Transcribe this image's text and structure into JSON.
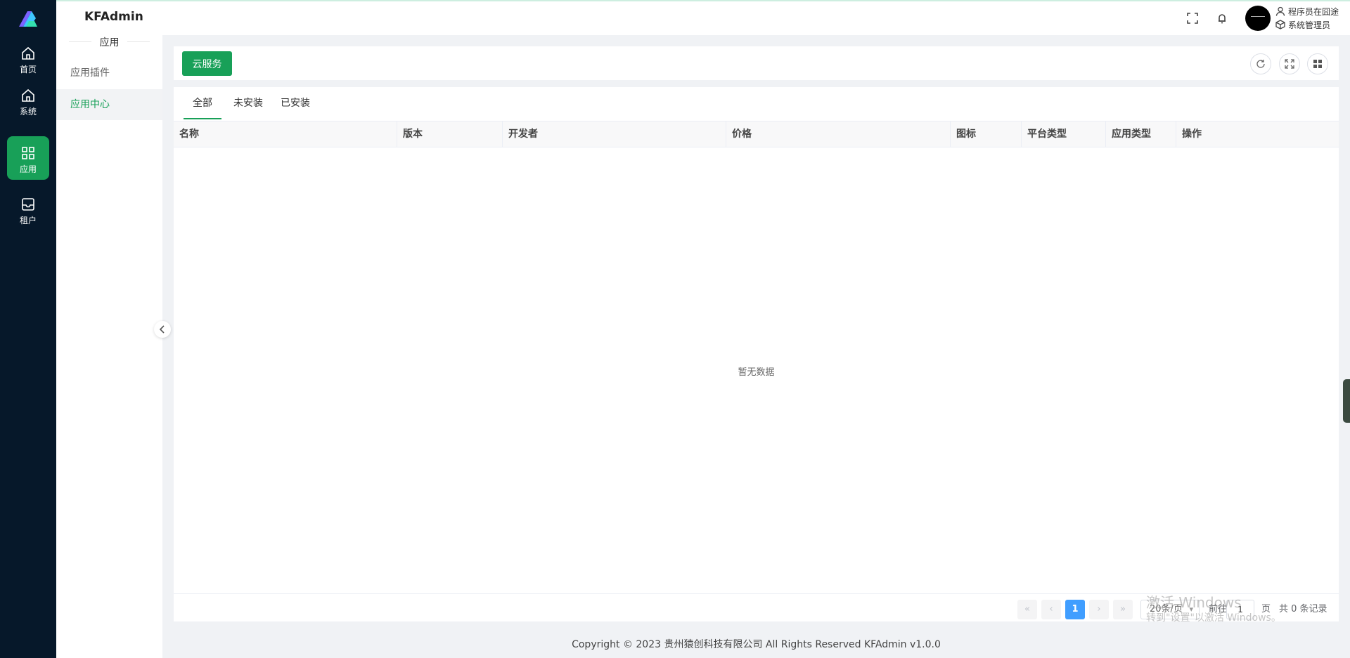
{
  "colors": {
    "accent": "#18a058",
    "rail_bg": "#06182a",
    "pager_active": "#409eff"
  },
  "brand": "KFAdmin",
  "rail": [
    {
      "label": "首页",
      "icon": "home-icon"
    },
    {
      "label": "系统",
      "icon": "home-icon"
    },
    {
      "label": "应用",
      "icon": "grid-icon",
      "active": true
    },
    {
      "label": "租户",
      "icon": "inbox-icon"
    }
  ],
  "user": {
    "name": "程序员在囧途",
    "role": "系统管理员"
  },
  "subnav": {
    "title": "应用",
    "items": [
      {
        "label": "应用插件"
      },
      {
        "label": "应用中心",
        "active": true
      }
    ]
  },
  "toolbar": {
    "cloud_button": "云服务"
  },
  "tabs": [
    {
      "label": "全部",
      "active": true
    },
    {
      "label": "未安装"
    },
    {
      "label": "已安装"
    }
  ],
  "table": {
    "columns": [
      "名称",
      "版本",
      "开发者",
      "价格",
      "图标",
      "平台类型",
      "应用类型",
      "操作"
    ],
    "rows": [],
    "empty_text": "暂无数据"
  },
  "pagination": {
    "current_page": "1",
    "page_size": "20条/页",
    "goto_label": "前往",
    "goto_value": "1",
    "page_suffix": "页",
    "total_text": "共 0 条记录"
  },
  "footer": "Copyright © 2023    贵州猿创科技有限公司 All Rights Reserved    KFAdmin v1.0.0",
  "watermark": {
    "line1": "激活 Windows",
    "line2": "转到\"设置\"以激活 Windows。"
  }
}
